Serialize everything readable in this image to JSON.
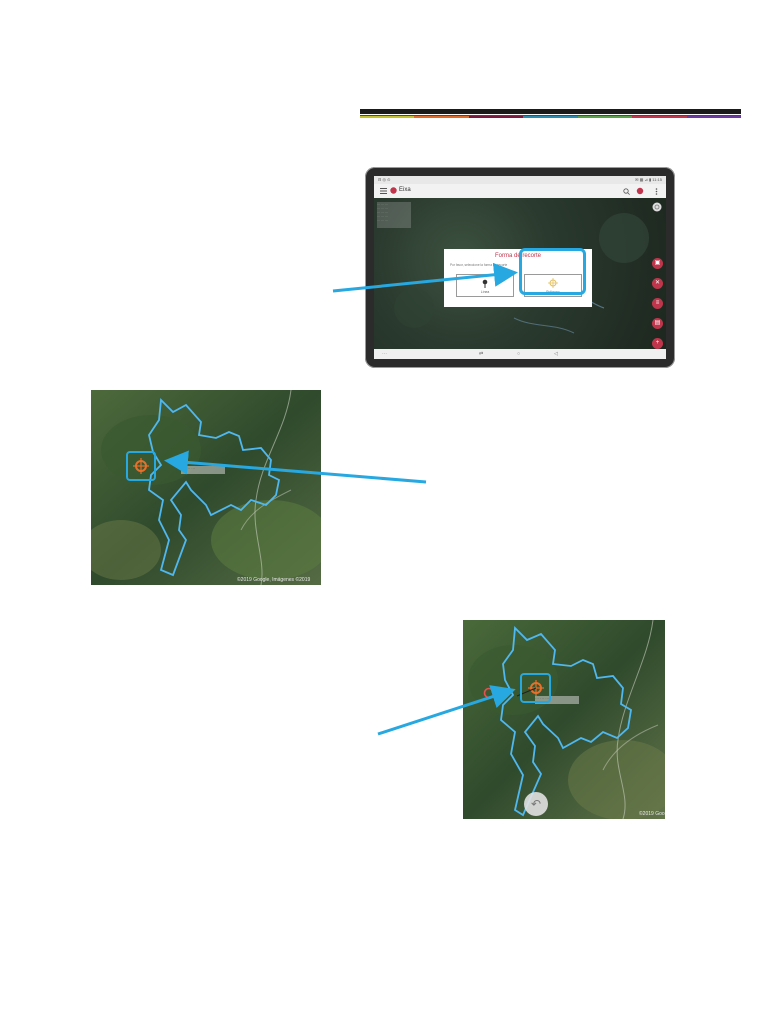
{
  "colors": {
    "accent": "#c0354b",
    "highlight": "#27a8e0",
    "boundary": "#4fb8f0",
    "target_orange": "#e8702a"
  },
  "header": {
    "stripe_colors": [
      "#c4c130",
      "#e06a2a",
      "#7a1a40",
      "#2a8ab0",
      "#5aa04a",
      "#c0354b",
      "#6a3aa0"
    ]
  },
  "tablet": {
    "status": {
      "left": "⊟ ◎ ⊙",
      "right": "✉ ▦ ⊿ ▮ 11:15"
    },
    "app": {
      "menu_icon": "hamburger-icon",
      "title": "Eixa",
      "actions": [
        "search-icon",
        "share-icon",
        "more-icon"
      ]
    },
    "map": {
      "info_lines": [
        "··· ··· ···",
        "··· ··· ···",
        "··· ··· ···",
        "··· ··· ···",
        "··· ··· ···"
      ]
    },
    "dialog": {
      "title": "Forma de recorte",
      "subtitle": "Por favor, seleccione la forma de recorte",
      "options": [
        {
          "label": "Línea",
          "icon": "pin-line-icon"
        },
        {
          "label": "Polígono",
          "icon": "crosshair-icon"
        }
      ]
    },
    "fabs": [
      "lock-icon",
      "close-icon",
      "layers-icon",
      "save-icon",
      "add-icon"
    ],
    "nav": [
      "⋯",
      "⇄",
      "○",
      "◁"
    ]
  },
  "panel_1": {
    "copyright": "©2019 Google, Imágenes ©2019",
    "label": "··· ··· ···",
    "icon": "crosshair-icon"
  },
  "panel_2": {
    "copyright": "©2019 Goo",
    "label": "··· ··· ···",
    "icon": "crosshair-icon",
    "undo_icon": "undo-icon",
    "undo_symbol": "↶"
  }
}
